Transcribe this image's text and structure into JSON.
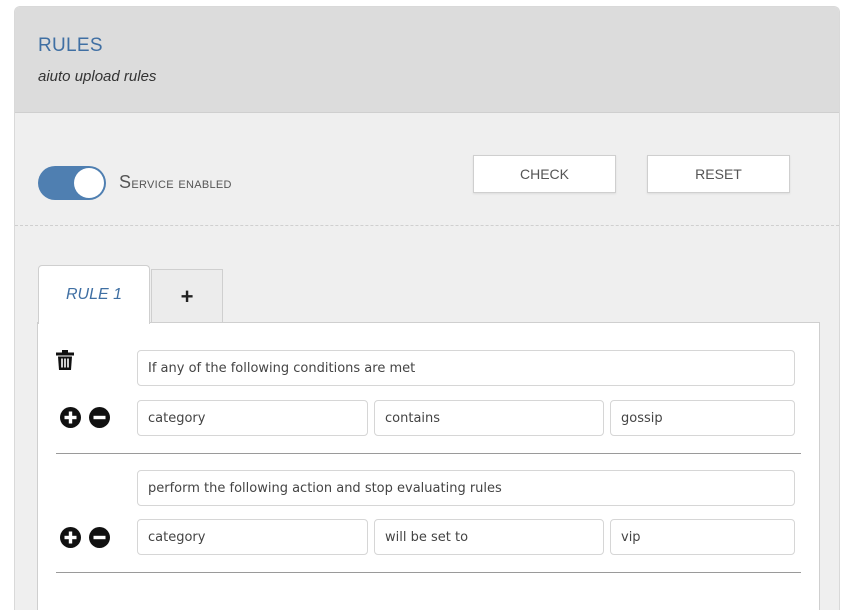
{
  "header": {
    "title": "RULES",
    "subtitle": "aiuto upload rules"
  },
  "toolbar": {
    "service_toggle_on": true,
    "service_label_first": "S",
    "service_label_rest": "ervice enabled",
    "check_label": "CHECK",
    "reset_label": "RESET"
  },
  "tabs": {
    "active_label": "RULE 1",
    "add_label": "+"
  },
  "rule": {
    "condition_header": "If any of the following conditions are met",
    "condition": {
      "field": "category",
      "operator": "contains",
      "value": "gossip"
    },
    "action_header": "perform the following action and stop evaluating rules",
    "action": {
      "field": "category",
      "operator": "will be set to",
      "value": "vip"
    }
  },
  "icons": {
    "delete": "trash-icon",
    "add": "plus-circle-icon",
    "remove": "minus-circle-icon"
  },
  "colors": {
    "accent": "#3f6fa3",
    "toggle": "#4f7fb1",
    "header_bg": "#dcdcdc",
    "panel_bg": "#efefef"
  }
}
